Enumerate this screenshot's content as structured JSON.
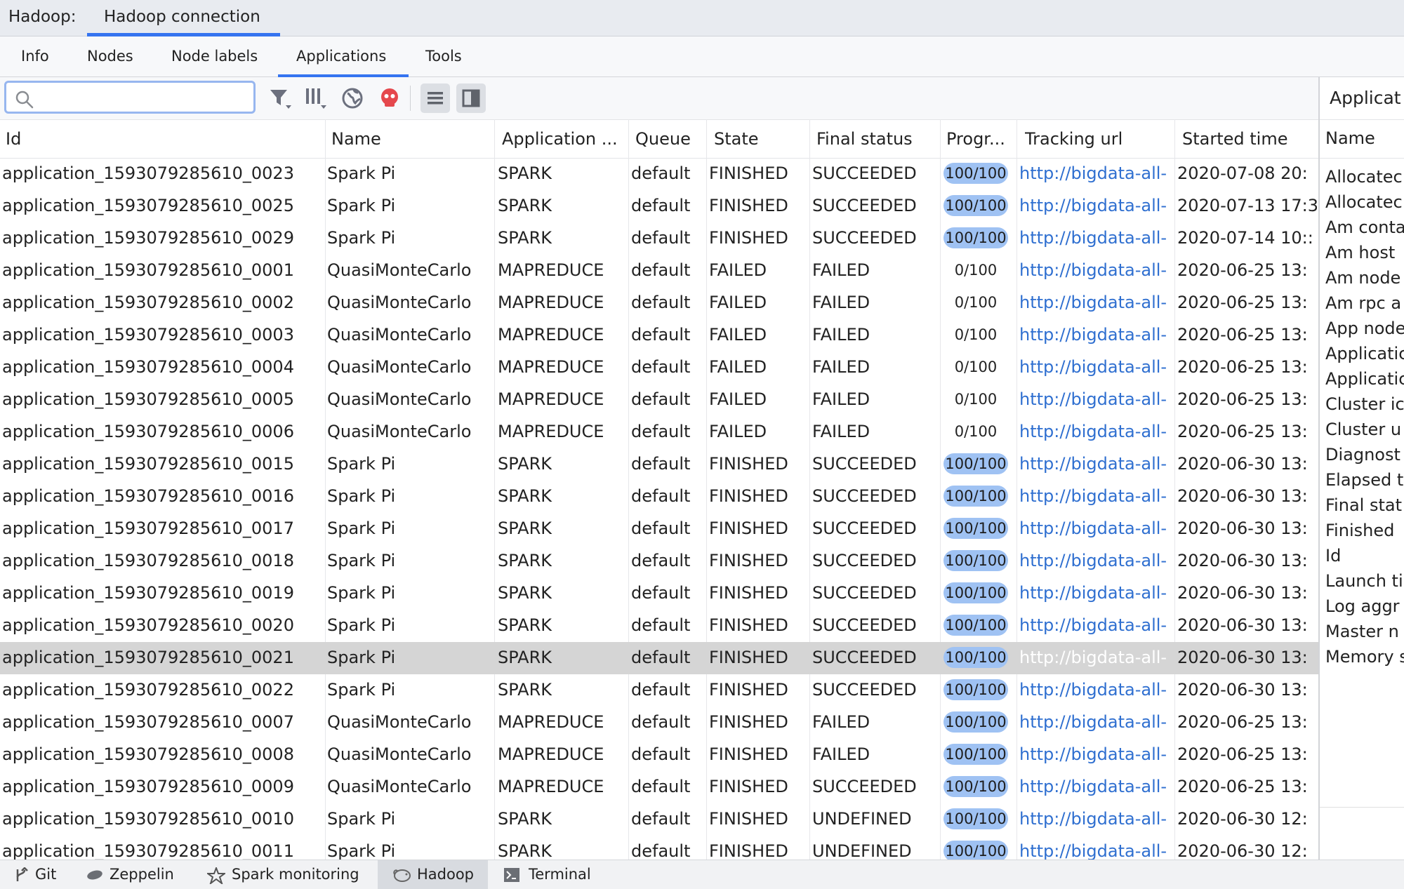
{
  "titlebar": {
    "prefix": "Hadoop:",
    "tab": "Hadoop connection"
  },
  "tabs": [
    {
      "label": "Info",
      "active": false
    },
    {
      "label": "Nodes",
      "active": false
    },
    {
      "label": "Node labels",
      "active": false
    },
    {
      "label": "Applications",
      "active": true
    },
    {
      "label": "Tools",
      "active": false
    }
  ],
  "search": {
    "value": "",
    "placeholder": ""
  },
  "toolbar_icons": [
    "filter-icon",
    "columns-icon",
    "globe-icon",
    "kill-icon",
    "list-view-icon",
    "details-panel-icon"
  ],
  "colors": {
    "accent": "#3574f0",
    "link": "#2f6fd0",
    "progress_fill": "#9fc2f3",
    "kill_red": "#e5484d",
    "selected_row": "#d5d5d5"
  },
  "table": {
    "columns": [
      "Id",
      "Name",
      "Application ...",
      "Queue",
      "State",
      "Final status",
      "Progr...",
      "Tracking url",
      "Started time"
    ],
    "selected_row_index": 15,
    "rows": [
      {
        "id": "application_1593079285610_0023",
        "name": "Spark Pi",
        "type": "SPARK",
        "queue": "default",
        "state": "FINISHED",
        "final_status": "SUCCEEDED",
        "progress": "100/100",
        "progress_pct": 100,
        "tracking_url": "http://bigdata-all-",
        "started": "2020-07-08 20:"
      },
      {
        "id": "application_1593079285610_0025",
        "name": "Spark Pi",
        "type": "SPARK",
        "queue": "default",
        "state": "FINISHED",
        "final_status": "SUCCEEDED",
        "progress": "100/100",
        "progress_pct": 100,
        "tracking_url": "http://bigdata-all-",
        "started": "2020-07-13 17:3"
      },
      {
        "id": "application_1593079285610_0029",
        "name": "Spark Pi",
        "type": "SPARK",
        "queue": "default",
        "state": "FINISHED",
        "final_status": "SUCCEEDED",
        "progress": "100/100",
        "progress_pct": 100,
        "tracking_url": "http://bigdata-all-",
        "started": "2020-07-14 10::"
      },
      {
        "id": "application_1593079285610_0001",
        "name": "QuasiMonteCarlo",
        "type": "MAPREDUCE",
        "queue": "default",
        "state": "FAILED",
        "final_status": "FAILED",
        "progress": "0/100",
        "progress_pct": 0,
        "tracking_url": "http://bigdata-all-",
        "started": "2020-06-25 13:"
      },
      {
        "id": "application_1593079285610_0002",
        "name": "QuasiMonteCarlo",
        "type": "MAPREDUCE",
        "queue": "default",
        "state": "FAILED",
        "final_status": "FAILED",
        "progress": "0/100",
        "progress_pct": 0,
        "tracking_url": "http://bigdata-all-",
        "started": "2020-06-25 13:"
      },
      {
        "id": "application_1593079285610_0003",
        "name": "QuasiMonteCarlo",
        "type": "MAPREDUCE",
        "queue": "default",
        "state": "FAILED",
        "final_status": "FAILED",
        "progress": "0/100",
        "progress_pct": 0,
        "tracking_url": "http://bigdata-all-",
        "started": "2020-06-25 13:"
      },
      {
        "id": "application_1593079285610_0004",
        "name": "QuasiMonteCarlo",
        "type": "MAPREDUCE",
        "queue": "default",
        "state": "FAILED",
        "final_status": "FAILED",
        "progress": "0/100",
        "progress_pct": 0,
        "tracking_url": "http://bigdata-all-",
        "started": "2020-06-25 13:"
      },
      {
        "id": "application_1593079285610_0005",
        "name": "QuasiMonteCarlo",
        "type": "MAPREDUCE",
        "queue": "default",
        "state": "FAILED",
        "final_status": "FAILED",
        "progress": "0/100",
        "progress_pct": 0,
        "tracking_url": "http://bigdata-all-",
        "started": "2020-06-25 13:"
      },
      {
        "id": "application_1593079285610_0006",
        "name": "QuasiMonteCarlo",
        "type": "MAPREDUCE",
        "queue": "default",
        "state": "FAILED",
        "final_status": "FAILED",
        "progress": "0/100",
        "progress_pct": 0,
        "tracking_url": "http://bigdata-all-",
        "started": "2020-06-25 13:"
      },
      {
        "id": "application_1593079285610_0015",
        "name": "Spark Pi",
        "type": "SPARK",
        "queue": "default",
        "state": "FINISHED",
        "final_status": "SUCCEEDED",
        "progress": "100/100",
        "progress_pct": 100,
        "tracking_url": "http://bigdata-all-",
        "started": "2020-06-30 13:"
      },
      {
        "id": "application_1593079285610_0016",
        "name": "Spark Pi",
        "type": "SPARK",
        "queue": "default",
        "state": "FINISHED",
        "final_status": "SUCCEEDED",
        "progress": "100/100",
        "progress_pct": 100,
        "tracking_url": "http://bigdata-all-",
        "started": "2020-06-30 13:"
      },
      {
        "id": "application_1593079285610_0017",
        "name": "Spark Pi",
        "type": "SPARK",
        "queue": "default",
        "state": "FINISHED",
        "final_status": "SUCCEEDED",
        "progress": "100/100",
        "progress_pct": 100,
        "tracking_url": "http://bigdata-all-",
        "started": "2020-06-30 13:"
      },
      {
        "id": "application_1593079285610_0018",
        "name": "Spark Pi",
        "type": "SPARK",
        "queue": "default",
        "state": "FINISHED",
        "final_status": "SUCCEEDED",
        "progress": "100/100",
        "progress_pct": 100,
        "tracking_url": "http://bigdata-all-",
        "started": "2020-06-30 13:"
      },
      {
        "id": "application_1593079285610_0019",
        "name": "Spark Pi",
        "type": "SPARK",
        "queue": "default",
        "state": "FINISHED",
        "final_status": "SUCCEEDED",
        "progress": "100/100",
        "progress_pct": 100,
        "tracking_url": "http://bigdata-all-",
        "started": "2020-06-30 13:"
      },
      {
        "id": "application_1593079285610_0020",
        "name": "Spark Pi",
        "type": "SPARK",
        "queue": "default",
        "state": "FINISHED",
        "final_status": "SUCCEEDED",
        "progress": "100/100",
        "progress_pct": 100,
        "tracking_url": "http://bigdata-all-",
        "started": "2020-06-30 13:"
      },
      {
        "id": "application_1593079285610_0021",
        "name": "Spark Pi",
        "type": "SPARK",
        "queue": "default",
        "state": "FINISHED",
        "final_status": "SUCCEEDED",
        "progress": "100/100",
        "progress_pct": 100,
        "tracking_url": "http://bigdata-all-",
        "started": "2020-06-30 13:"
      },
      {
        "id": "application_1593079285610_0022",
        "name": "Spark Pi",
        "type": "SPARK",
        "queue": "default",
        "state": "FINISHED",
        "final_status": "SUCCEEDED",
        "progress": "100/100",
        "progress_pct": 100,
        "tracking_url": "http://bigdata-all-",
        "started": "2020-06-30 13:"
      },
      {
        "id": "application_1593079285610_0007",
        "name": "QuasiMonteCarlo",
        "type": "MAPREDUCE",
        "queue": "default",
        "state": "FINISHED",
        "final_status": "FAILED",
        "progress": "100/100",
        "progress_pct": 100,
        "tracking_url": "http://bigdata-all-",
        "started": "2020-06-25 13:"
      },
      {
        "id": "application_1593079285610_0008",
        "name": "QuasiMonteCarlo",
        "type": "MAPREDUCE",
        "queue": "default",
        "state": "FINISHED",
        "final_status": "FAILED",
        "progress": "100/100",
        "progress_pct": 100,
        "tracking_url": "http://bigdata-all-",
        "started": "2020-06-25 13:"
      },
      {
        "id": "application_1593079285610_0009",
        "name": "QuasiMonteCarlo",
        "type": "MAPREDUCE",
        "queue": "default",
        "state": "FINISHED",
        "final_status": "SUCCEEDED",
        "progress": "100/100",
        "progress_pct": 100,
        "tracking_url": "http://bigdata-all-",
        "started": "2020-06-25 13:"
      },
      {
        "id": "application_1593079285610_0010",
        "name": "Spark Pi",
        "type": "SPARK",
        "queue": "default",
        "state": "FINISHED",
        "final_status": "UNDEFINED",
        "progress": "100/100",
        "progress_pct": 100,
        "tracking_url": "http://bigdata-all-",
        "started": "2020-06-30 12:"
      },
      {
        "id": "application_1593079285610_0011",
        "name": "Spark Pi",
        "type": "SPARK",
        "queue": "default",
        "state": "FINISHED",
        "final_status": "UNDEFINED",
        "progress": "100/100",
        "progress_pct": 100,
        "tracking_url": "http://bigdata-all-",
        "started": "2020-06-30 12:"
      }
    ]
  },
  "details_panel": {
    "title": "Applicat",
    "header": "Name",
    "rows": [
      "Allocatec",
      "Allocatec",
      "Am conta",
      "Am host",
      "Am node",
      "Am rpc a",
      "App node",
      "Applicatic",
      "Applicatic",
      "Cluster ic",
      "Cluster u",
      "Diagnost",
      "Elapsed t",
      "Final stat",
      "Finished",
      "Id",
      "Launch ti",
      "Log aggr",
      "Master n",
      "Memory s"
    ]
  },
  "statusbar": [
    {
      "label": "Git",
      "icon": "git-icon",
      "active": false
    },
    {
      "label": "Zeppelin",
      "icon": "zeppelin-icon",
      "active": false
    },
    {
      "label": "Spark monitoring",
      "icon": "spark-icon",
      "active": false
    },
    {
      "label": "Hadoop",
      "icon": "hadoop-icon",
      "active": true
    },
    {
      "label": "Terminal",
      "icon": "terminal-icon",
      "active": false
    }
  ]
}
